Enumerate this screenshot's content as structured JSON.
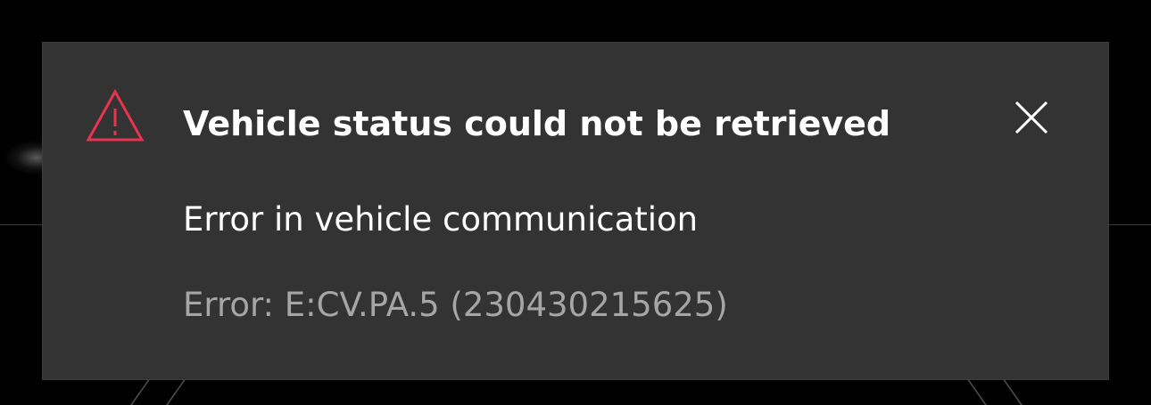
{
  "dialog": {
    "title": "Vehicle status could not be retrieved",
    "message": "Error in vehicle communication",
    "error_code": "Error: E:CV.PA.5 (230430215625)",
    "icon": "warning-triangle-icon",
    "close_icon": "close-icon"
  },
  "colors": {
    "background": "#000000",
    "dialog_background": "#333333",
    "warning_accent": "#e8344e",
    "primary_text": "#ffffff",
    "secondary_text": "#a6a6a6"
  }
}
